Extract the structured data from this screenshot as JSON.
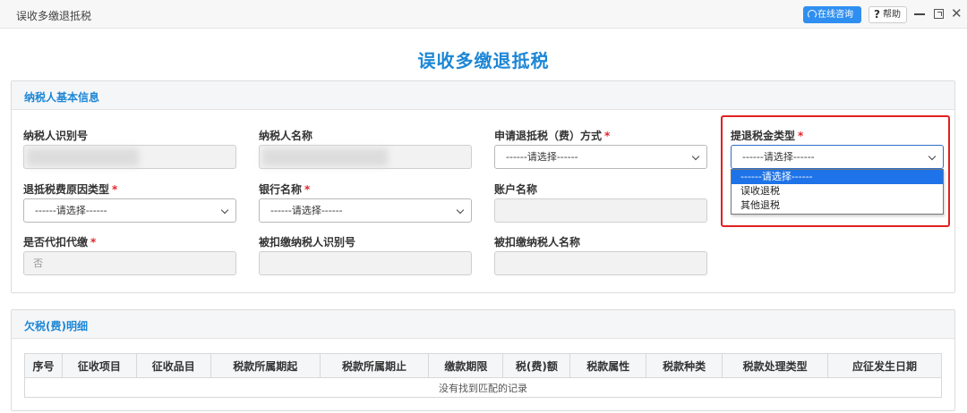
{
  "window": {
    "title": "误收多缴退抵税",
    "consult_label": "在线咨询",
    "help_label": "帮助",
    "help_glyph": "?"
  },
  "page_title": "误收多缴退抵税",
  "taxpayer_section": {
    "header": "纳税人基本信息",
    "fields": {
      "taxpayer_id": {
        "label": "纳税人识别号",
        "required": false,
        "value": ""
      },
      "taxpayer_name": {
        "label": "纳税人名称",
        "required": false,
        "value": ""
      },
      "refund_method": {
        "label": "申请退抵税（费）方式",
        "required": true,
        "value": "------请选择------"
      },
      "refund_type": {
        "label": "提退税金类型",
        "required": true,
        "value": "------请选择------"
      },
      "refund_reason": {
        "label": "退抵税费原因类型",
        "required": true,
        "value": "------请选择------"
      },
      "bank_name": {
        "label": "银行名称",
        "required": true,
        "value": "------请选择------"
      },
      "account_name": {
        "label": "账户名称",
        "required": false,
        "value": ""
      },
      "withholding": {
        "label": "是否代扣代缴",
        "required": true,
        "value": "否"
      },
      "withheld_taxpayer_id": {
        "label": "被扣缴纳税人识别号",
        "required": false,
        "value": ""
      },
      "withheld_taxpayer_name": {
        "label": "被扣缴纳税人名称",
        "required": false,
        "value": ""
      }
    },
    "required_mark": "*",
    "refund_type_dropdown": {
      "options": [
        "------请选择------",
        "误收退税",
        "其他退税"
      ],
      "selected_index": 0
    }
  },
  "arrears_section": {
    "header": "欠税(费)明细",
    "columns": [
      "序号",
      "征收项目",
      "征收品目",
      "税款所属期起",
      "税款所属期止",
      "缴款期限",
      "税(费)额",
      "税款属性",
      "税款种类",
      "税款处理类型",
      "应征发生日期"
    ],
    "empty_message": "没有找到匹配的记录"
  },
  "colors": {
    "accent": "#1d87d6",
    "required": "#e5252a",
    "highlight": "#e02020",
    "consult_button": "#2f8ff0",
    "dropdown_selected": "#1e73e8"
  },
  "icons": {
    "consult": "headset-icon",
    "help": "question-icon",
    "minimize": "minimize-icon",
    "maximize": "maximize-icon",
    "close": "close-icon",
    "select": "chevron-down-icon"
  }
}
